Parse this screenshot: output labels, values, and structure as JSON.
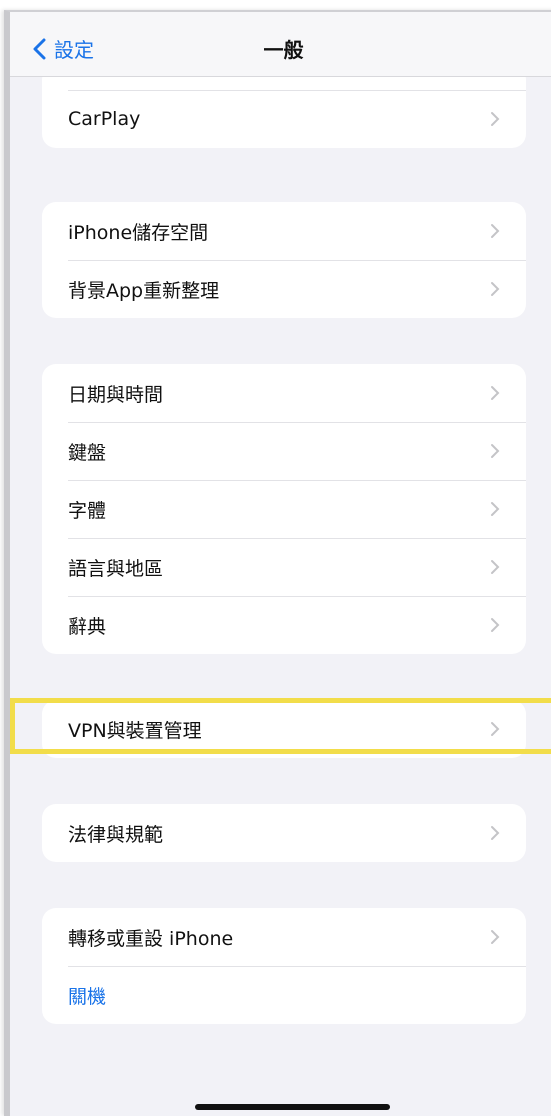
{
  "navbar": {
    "back_label": "設定",
    "title": "一般"
  },
  "groups": [
    {
      "rows": [
        {
          "label": "CarPlay"
        }
      ]
    },
    {
      "rows": [
        {
          "label": "iPhone儲存空間"
        },
        {
          "label": "背景App重新整理"
        }
      ]
    },
    {
      "rows": [
        {
          "label": "日期與時間"
        },
        {
          "label": "鍵盤"
        },
        {
          "label": "字體"
        },
        {
          "label": "語言與地區"
        },
        {
          "label": "辭典"
        }
      ]
    },
    {
      "rows": [
        {
          "label": "VPN與裝置管理"
        }
      ]
    },
    {
      "rows": [
        {
          "label": "法律與規範"
        }
      ]
    },
    {
      "rows": [
        {
          "label": "轉移或重設 iPhone"
        },
        {
          "label": "關機"
        }
      ]
    }
  ],
  "colors": {
    "accent": "#1a73e8",
    "highlight": "#f2dd4a",
    "background": "#f2f2f7"
  }
}
